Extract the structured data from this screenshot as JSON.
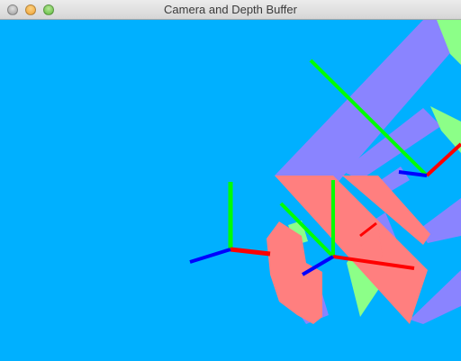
{
  "window": {
    "title": "Camera and Depth Buffer"
  },
  "scene": {
    "background_color": "#00b0ff",
    "face_colors": {
      "purple": "#8a84ff",
      "pink": "#ff7f7f",
      "green": "#8cff88"
    },
    "axis_colors": {
      "x": "#ff0000",
      "y": "#00ff00",
      "z": "#0000ff"
    }
  }
}
